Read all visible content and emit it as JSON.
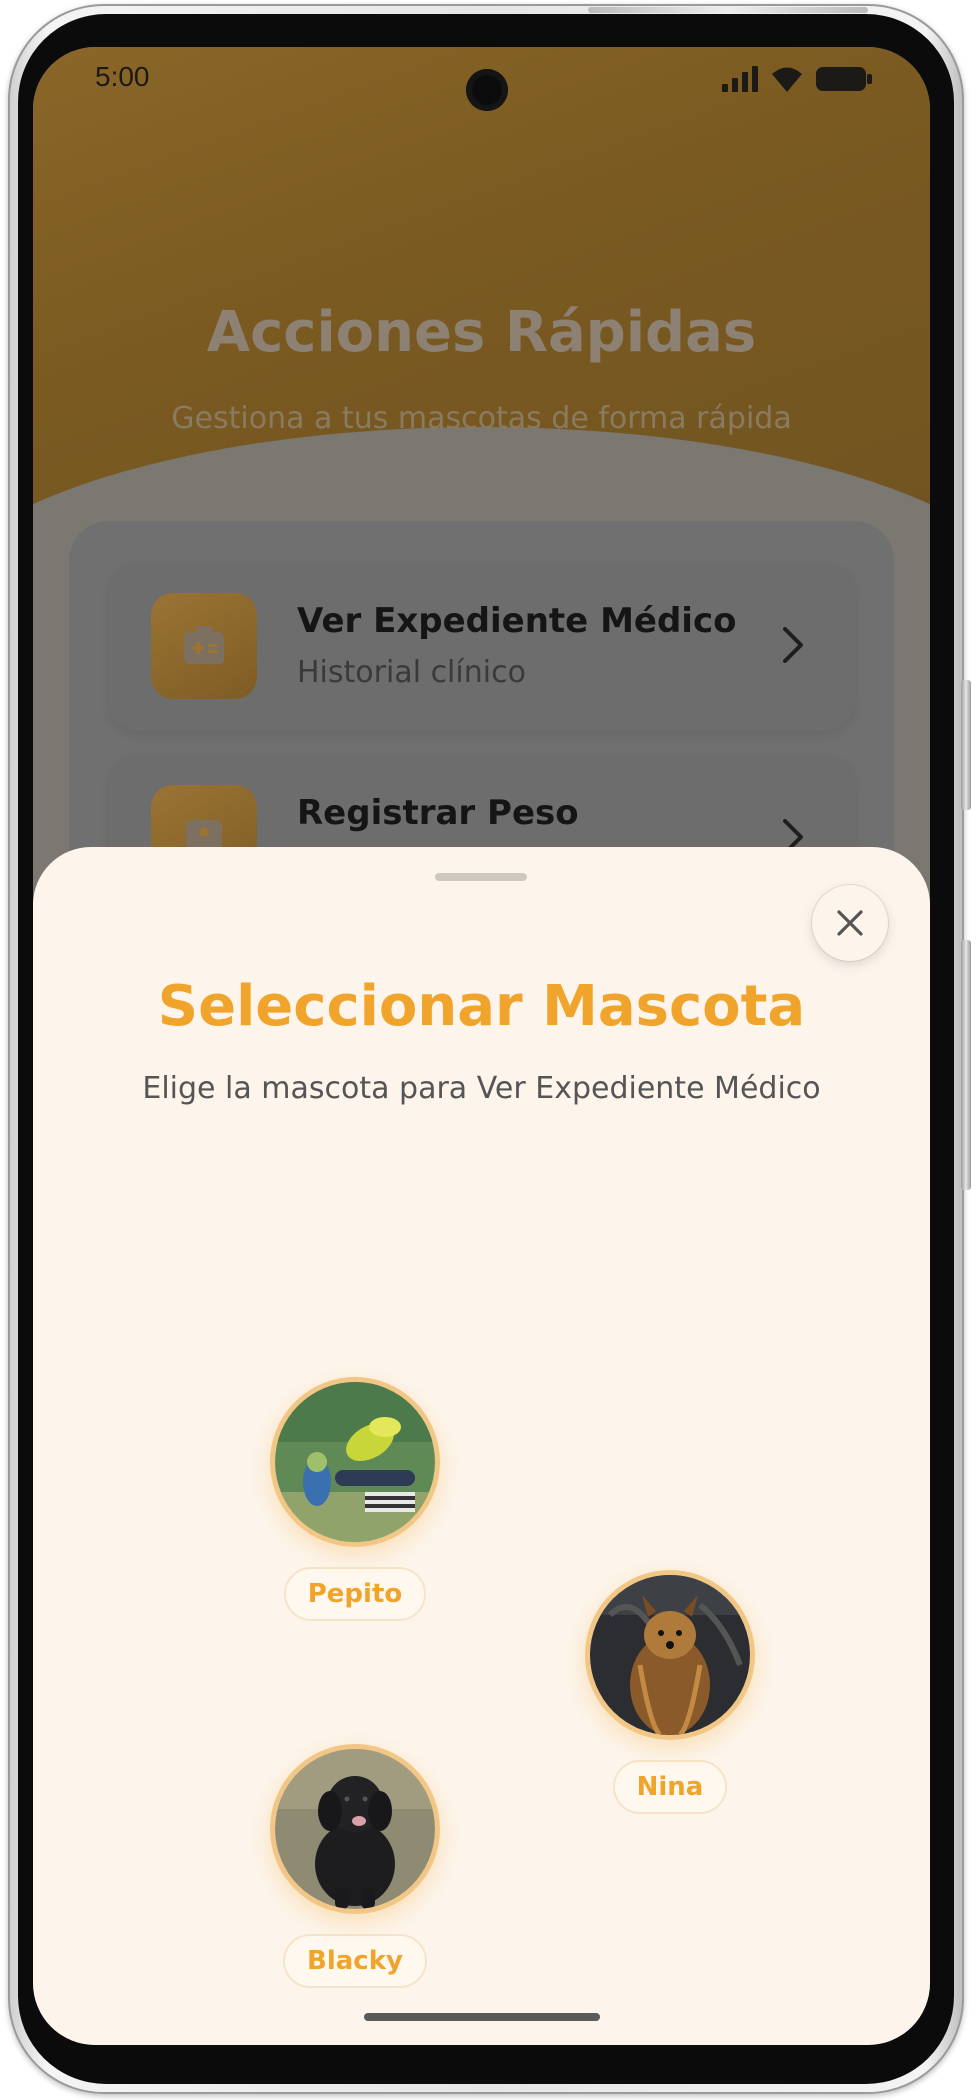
{
  "status_bar": {
    "time": "5:00"
  },
  "background_screen": {
    "title": "Acciones Rápidas",
    "subtitle": "Gestiona a tus mascotas de forma rápida",
    "actions": [
      {
        "title": "Ver Expediente Médico",
        "subtitle": "Historial clínico",
        "icon": "medical-record-icon"
      },
      {
        "title": "Registrar Peso",
        "subtitle": "",
        "icon": "scale-icon"
      }
    ]
  },
  "sheet": {
    "title": "Seleccionar Mascota",
    "subtitle": "Elige la mascota para Ver Expediente Médico",
    "close_icon": "close-icon",
    "pets": [
      {
        "name": "Pepito",
        "photo": "parakeet-photo"
      },
      {
        "name": "Nina",
        "photo": "yorkshire-terrier-photo"
      },
      {
        "name": "Blacky",
        "photo": "black-poodle-photo"
      }
    ]
  },
  "colors": {
    "accent": "#f0a42b",
    "sheet_background": "#fdf5ec",
    "header_background": "#7a5a21"
  }
}
